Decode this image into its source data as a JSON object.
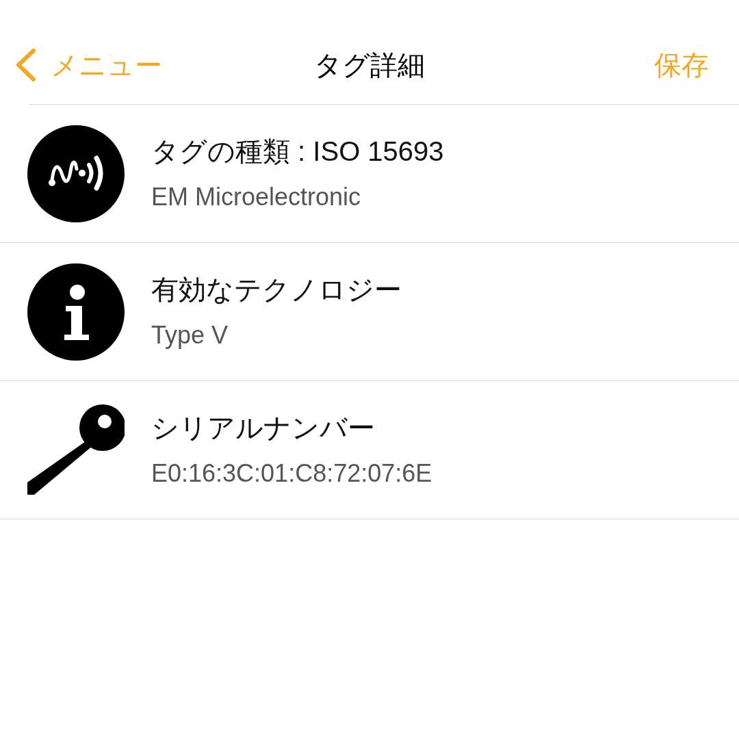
{
  "nav": {
    "back_label": "メニュー",
    "title": "タグ詳細",
    "save_label": "保存"
  },
  "rows": [
    {
      "kind": "nfc",
      "title": "タグの種類 : ISO 15693",
      "detail": "EM Microelectronic"
    },
    {
      "kind": "info",
      "title": "有効なテクノロジー",
      "detail": "Type V"
    },
    {
      "kind": "key",
      "title": "シリアルナンバー",
      "detail": "E0:16:3C:01:C8:72:07:6E"
    }
  ]
}
